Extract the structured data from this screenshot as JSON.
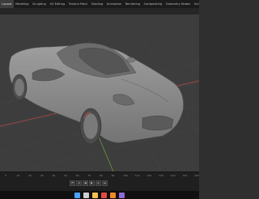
{
  "menubar": {
    "items": [
      "Layout",
      "Modeling",
      "Sculpting",
      "UV Editing",
      "Texture Paint",
      "Shading",
      "Animation",
      "Rendering",
      "Compositing",
      "Geometry Nodes",
      "Scripting"
    ],
    "active_index": 0
  },
  "timeline": {
    "ticks": [
      "0",
      "10",
      "20",
      "30",
      "40",
      "50",
      "60",
      "70",
      "80",
      "90",
      "100",
      "110",
      "120",
      "130",
      "140",
      "150",
      "160"
    ]
  },
  "playback": {
    "buttons": [
      {
        "name": "jump-start-icon",
        "glyph": "⏮"
      },
      {
        "name": "step-back-icon",
        "glyph": "◂"
      },
      {
        "name": "play-reverse-icon",
        "glyph": "◀"
      },
      {
        "name": "play-icon",
        "glyph": "▶"
      },
      {
        "name": "step-forward-icon",
        "glyph": "▸"
      },
      {
        "name": "jump-end-icon",
        "glyph": "⏭"
      }
    ]
  },
  "taskbar": {
    "icons": [
      {
        "name": "windows-start-icon",
        "color": "#4aa3ff"
      },
      {
        "name": "search-icon",
        "color": "#d0d0d0"
      },
      {
        "name": "file-explorer-icon",
        "color": "#f2c14e"
      },
      {
        "name": "chrome-icon",
        "color": "#e34c3c"
      },
      {
        "name": "blender-icon",
        "color": "#f08a24"
      },
      {
        "name": "app-icon",
        "color": "#8f6ad8"
      }
    ]
  },
  "colors": {
    "viewport_bg": "#3d3d3d",
    "car_body": "#8f8f8f",
    "axis_x": "#b84a4a",
    "axis_y": "#6a9a3a"
  }
}
